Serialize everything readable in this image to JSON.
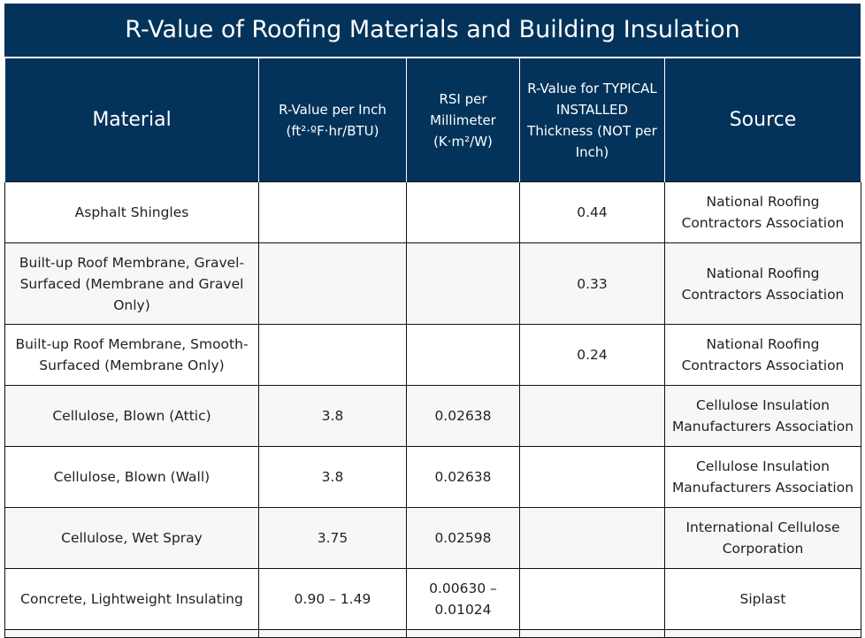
{
  "title": "R-Value of Roofing Materials and Building Insulation",
  "columns": [
    "Material",
    "R-Value per Inch (ft²·ºF·hr/BTU)",
    "RSI per Millimeter (K·m²/W)",
    "R-Value for TYPICAL INSTALLED Thickness (NOT per Inch)",
    "Source"
  ],
  "rows": [
    {
      "material": "Asphalt Shingles",
      "r_per_inch": "",
      "rsi_per_mm": "",
      "r_typical": "0.44",
      "source": "National Roofing Contractors Association"
    },
    {
      "material": "Built-up Roof Membrane, Gravel-Surfaced (Membrane and Gravel Only)",
      "r_per_inch": "",
      "rsi_per_mm": "",
      "r_typical": "0.33",
      "source": "National Roofing Contractors Association"
    },
    {
      "material": "Built-up Roof Membrane, Smooth-Surfaced (Membrane Only)",
      "r_per_inch": "",
      "rsi_per_mm": "",
      "r_typical": "0.24",
      "source": "National Roofing Contractors Association"
    },
    {
      "material": "Cellulose, Blown (Attic)",
      "r_per_inch": "3.8",
      "rsi_per_mm": "0.02638",
      "r_typical": "",
      "source": "Cellulose Insulation Manufacturers Association"
    },
    {
      "material": "Cellulose, Blown (Wall)",
      "r_per_inch": "3.8",
      "rsi_per_mm": "0.02638",
      "r_typical": "",
      "source": "Cellulose Insulation Manufacturers Association"
    },
    {
      "material": "Cellulose, Wet Spray",
      "r_per_inch": "3.75",
      "rsi_per_mm": "0.02598",
      "r_typical": "",
      "source": "International Cellulose Corporation"
    },
    {
      "material": "Concrete, Lightweight Insulating",
      "r_per_inch": "0.90 – 1.49",
      "rsi_per_mm": "0.00630 – 0.01024",
      "r_typical": "",
      "source": "Siplast"
    }
  ]
}
